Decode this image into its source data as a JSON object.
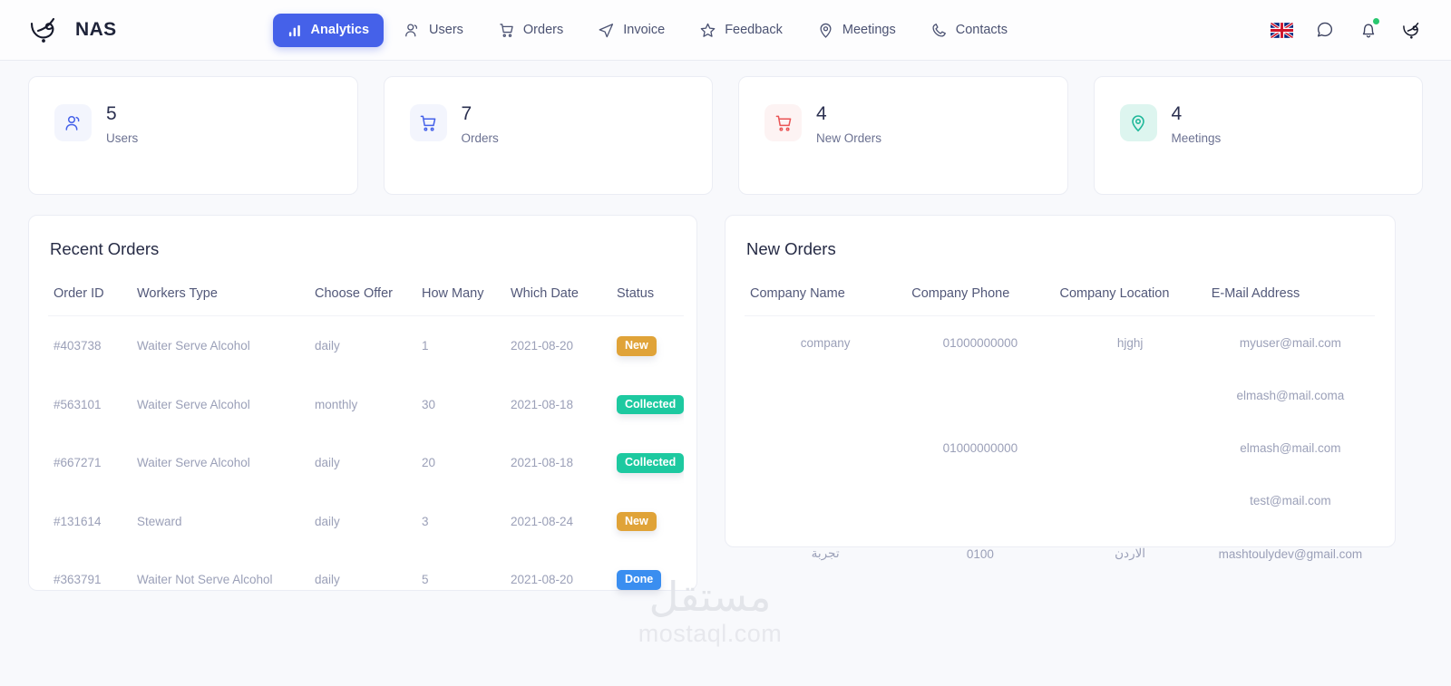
{
  "app": {
    "brand_name": "NAS",
    "logo_icon": "nas-calligraphy-logo"
  },
  "navbar": {
    "items": [
      {
        "label": "Analytics",
        "icon": "bar-chart-icon",
        "active": true
      },
      {
        "label": "Users",
        "icon": "users-icon",
        "active": false
      },
      {
        "label": "Orders",
        "icon": "shopping-cart-icon",
        "active": false
      },
      {
        "label": "Invoice",
        "icon": "send-paper-plane-icon",
        "active": false
      },
      {
        "label": "Feedback",
        "icon": "star-icon",
        "active": false
      },
      {
        "label": "Meetings",
        "icon": "map-pin-icon",
        "active": false
      },
      {
        "label": "Contacts",
        "icon": "phone-icon",
        "active": false
      }
    ],
    "right": {
      "language_flag": "uk-flag-icon",
      "messages_icon": "chat-bubble-icon",
      "notifications_icon": "bell-icon",
      "notifications_has_unread": true,
      "avatar_icon": "nas-calligraphy-logo"
    },
    "accent_color": "#4561e9"
  },
  "stats": [
    {
      "value": "5",
      "label": "Users",
      "icon": "users-icon",
      "icon_color": "#4561e9",
      "icon_bg": "#f3f5fd"
    },
    {
      "value": "7",
      "label": "Orders",
      "icon": "shopping-cart-icon",
      "icon_color": "#4561e9",
      "icon_bg": "#f3f5fd"
    },
    {
      "value": "4",
      "label": "New Orders",
      "icon": "shopping-cart-icon",
      "icon_color": "#ea5455",
      "icon_bg": "#fdf3f3"
    },
    {
      "value": "4",
      "label": "Meetings",
      "icon": "map-pin-icon",
      "icon_color": "#20b89a",
      "icon_bg": "#ddf5ef"
    }
  ],
  "recent_orders": {
    "title": "Recent Orders",
    "columns": [
      "Order ID",
      "Workers Type",
      "Choose Offer",
      "How Many",
      "Which Date",
      "Status"
    ],
    "rows": [
      {
        "order_id": "#403738",
        "workers_type": "Waiter Serve Alcohol",
        "offer": "daily",
        "how_many": "1",
        "date": "2021-08-20",
        "status": "New",
        "status_kind": "new"
      },
      {
        "order_id": "#563101",
        "workers_type": "Waiter Serve Alcohol",
        "offer": "monthly",
        "how_many": "30",
        "date": "2021-08-18",
        "status": "Collected",
        "status_kind": "collected"
      },
      {
        "order_id": "#667271",
        "workers_type": "Waiter Serve Alcohol",
        "offer": "daily",
        "how_many": "20",
        "date": "2021-08-18",
        "status": "Collected",
        "status_kind": "collected"
      },
      {
        "order_id": "#131614",
        "workers_type": "Steward",
        "offer": "daily",
        "how_many": "3",
        "date": "2021-08-24",
        "status": "New",
        "status_kind": "new"
      },
      {
        "order_id": "#363791",
        "workers_type": "Waiter Not Serve Alcohol",
        "offer": "daily",
        "how_many": "5",
        "date": "2021-08-20",
        "status": "Done",
        "status_kind": "done"
      }
    ],
    "status_colors": {
      "new": "#e0a338",
      "collected": "#1dc9a0",
      "done": "#3a8ef0"
    }
  },
  "new_orders": {
    "title": "New Orders",
    "columns": [
      "Company Name",
      "Company Phone",
      "Company Location",
      "E-Mail Address"
    ],
    "rows": [
      {
        "company_name": "company",
        "phone": "01000000000",
        "location": "hjghj",
        "email": "myuser@mail.com"
      },
      {
        "company_name": "",
        "phone": "",
        "location": "",
        "email": "elmash@mail.coma"
      },
      {
        "company_name": "",
        "phone": "01000000000",
        "location": "",
        "email": "elmash@mail.com"
      },
      {
        "company_name": "",
        "phone": "",
        "location": "",
        "email": "test@mail.com"
      },
      {
        "company_name": "تجربة",
        "phone": "0100",
        "location": "الاردن",
        "email": "mashtoulydev@gmail.com"
      }
    ]
  },
  "watermark": {
    "arabic": "مستقل",
    "latin": "mostaql.com"
  }
}
